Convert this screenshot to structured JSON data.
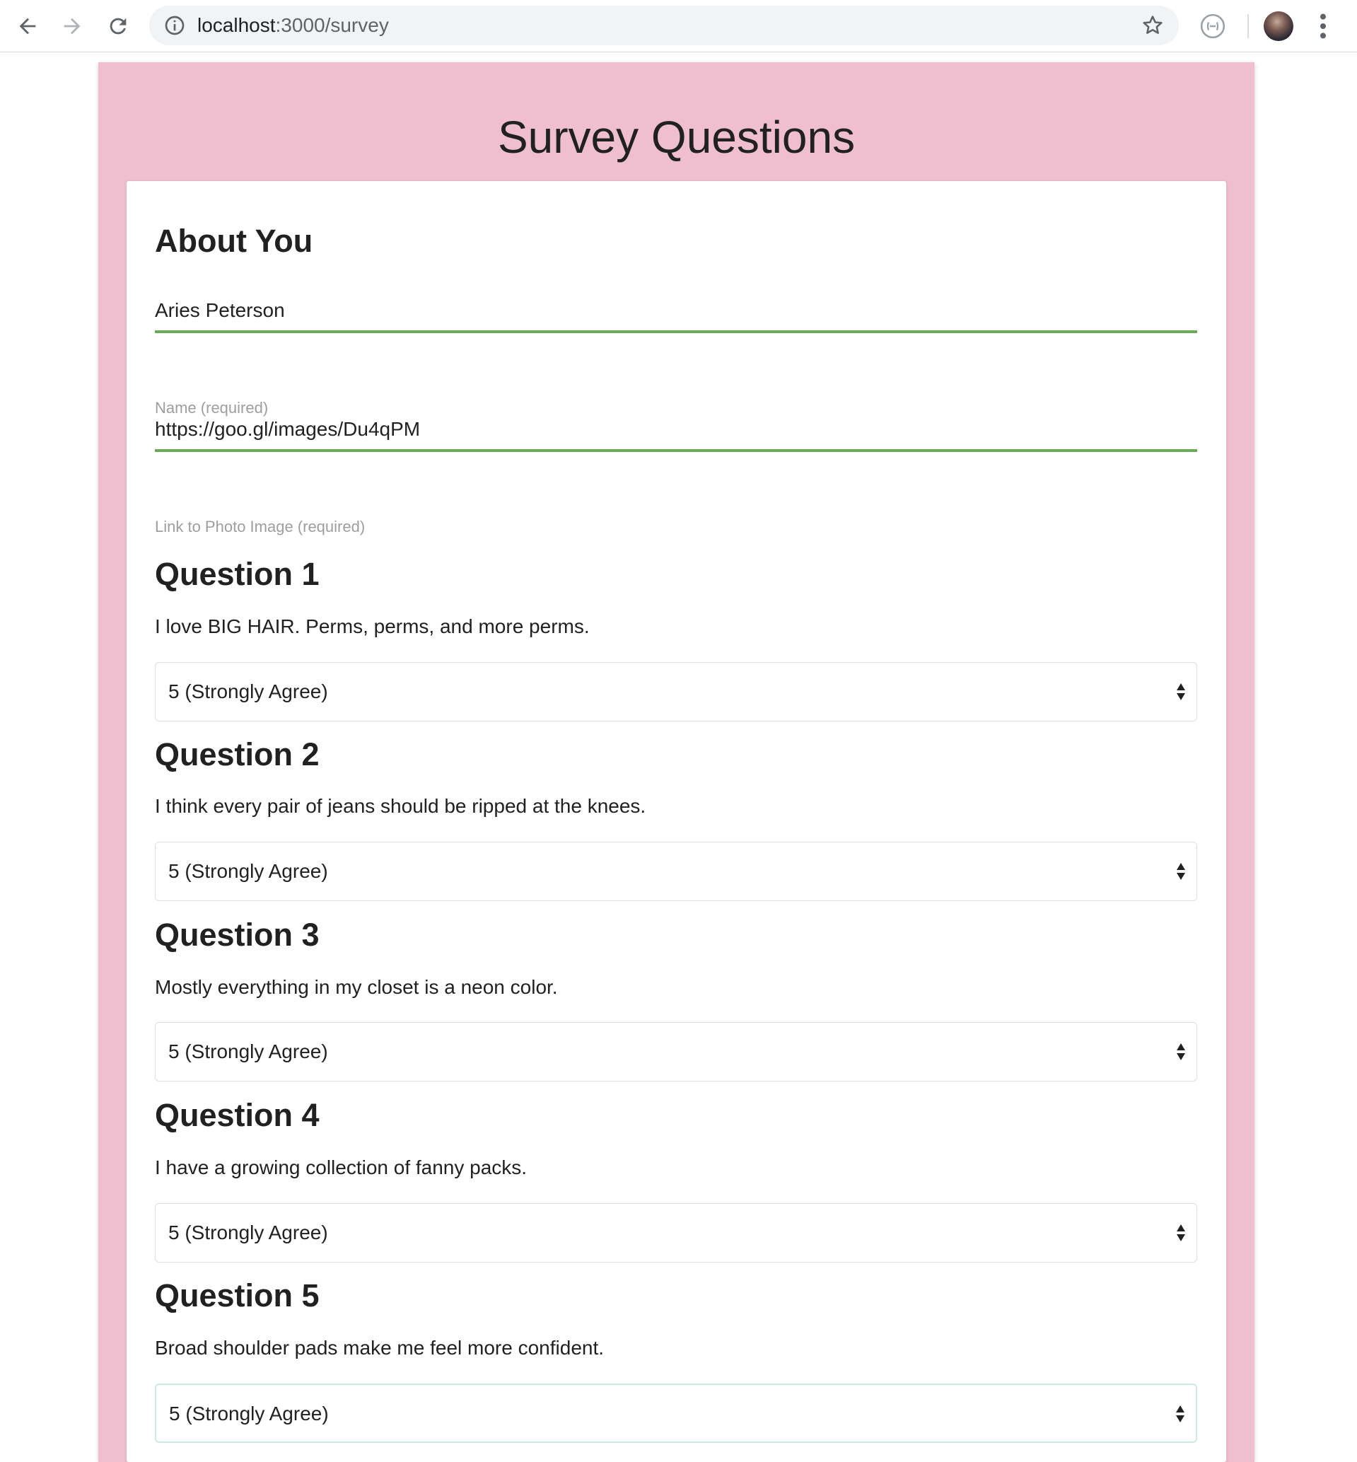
{
  "browser": {
    "url_host": "localhost",
    "url_path": ":3000/survey"
  },
  "page": {
    "title": "Survey Questions"
  },
  "about": {
    "heading": "About You",
    "name_value": "Aries Peterson",
    "name_label": "Name (required)",
    "photo_value": "https://goo.gl/images/Du4qPM",
    "photo_label": "Link to Photo Image (required)"
  },
  "questions": [
    {
      "heading": "Question 1",
      "text": "I love BIG HAIR. Perms, perms, and more perms.",
      "selected": "5 (Strongly Agree)"
    },
    {
      "heading": "Question 2",
      "text": "I think every pair of jeans should be ripped at the knees.",
      "selected": "5 (Strongly Agree)"
    },
    {
      "heading": "Question 3",
      "text": "Mostly everything in my closet is a neon color.",
      "selected": "5 (Strongly Agree)"
    },
    {
      "heading": "Question 4",
      "text": "I have a growing collection of fanny packs.",
      "selected": "5 (Strongly Agree)"
    },
    {
      "heading": "Question 5",
      "text": "Broad shoulder pads make me feel more confident.",
      "selected": "5 (Strongly Agree)"
    }
  ],
  "icons": {
    "back": "back-arrow-icon",
    "forward": "forward-arrow-icon",
    "reload": "reload-icon",
    "info": "info-icon",
    "bookmark": "star-icon",
    "extension": "extension-icon",
    "menu": "kebab-menu-icon",
    "select": "select-arrows-icon"
  },
  "colors": {
    "page_background": "#efbfcf",
    "card_background": "#ffffff",
    "input_underline": "#6aaa57",
    "label_gray": "#9e9e9e",
    "omnibox": "#f1f3f4"
  }
}
